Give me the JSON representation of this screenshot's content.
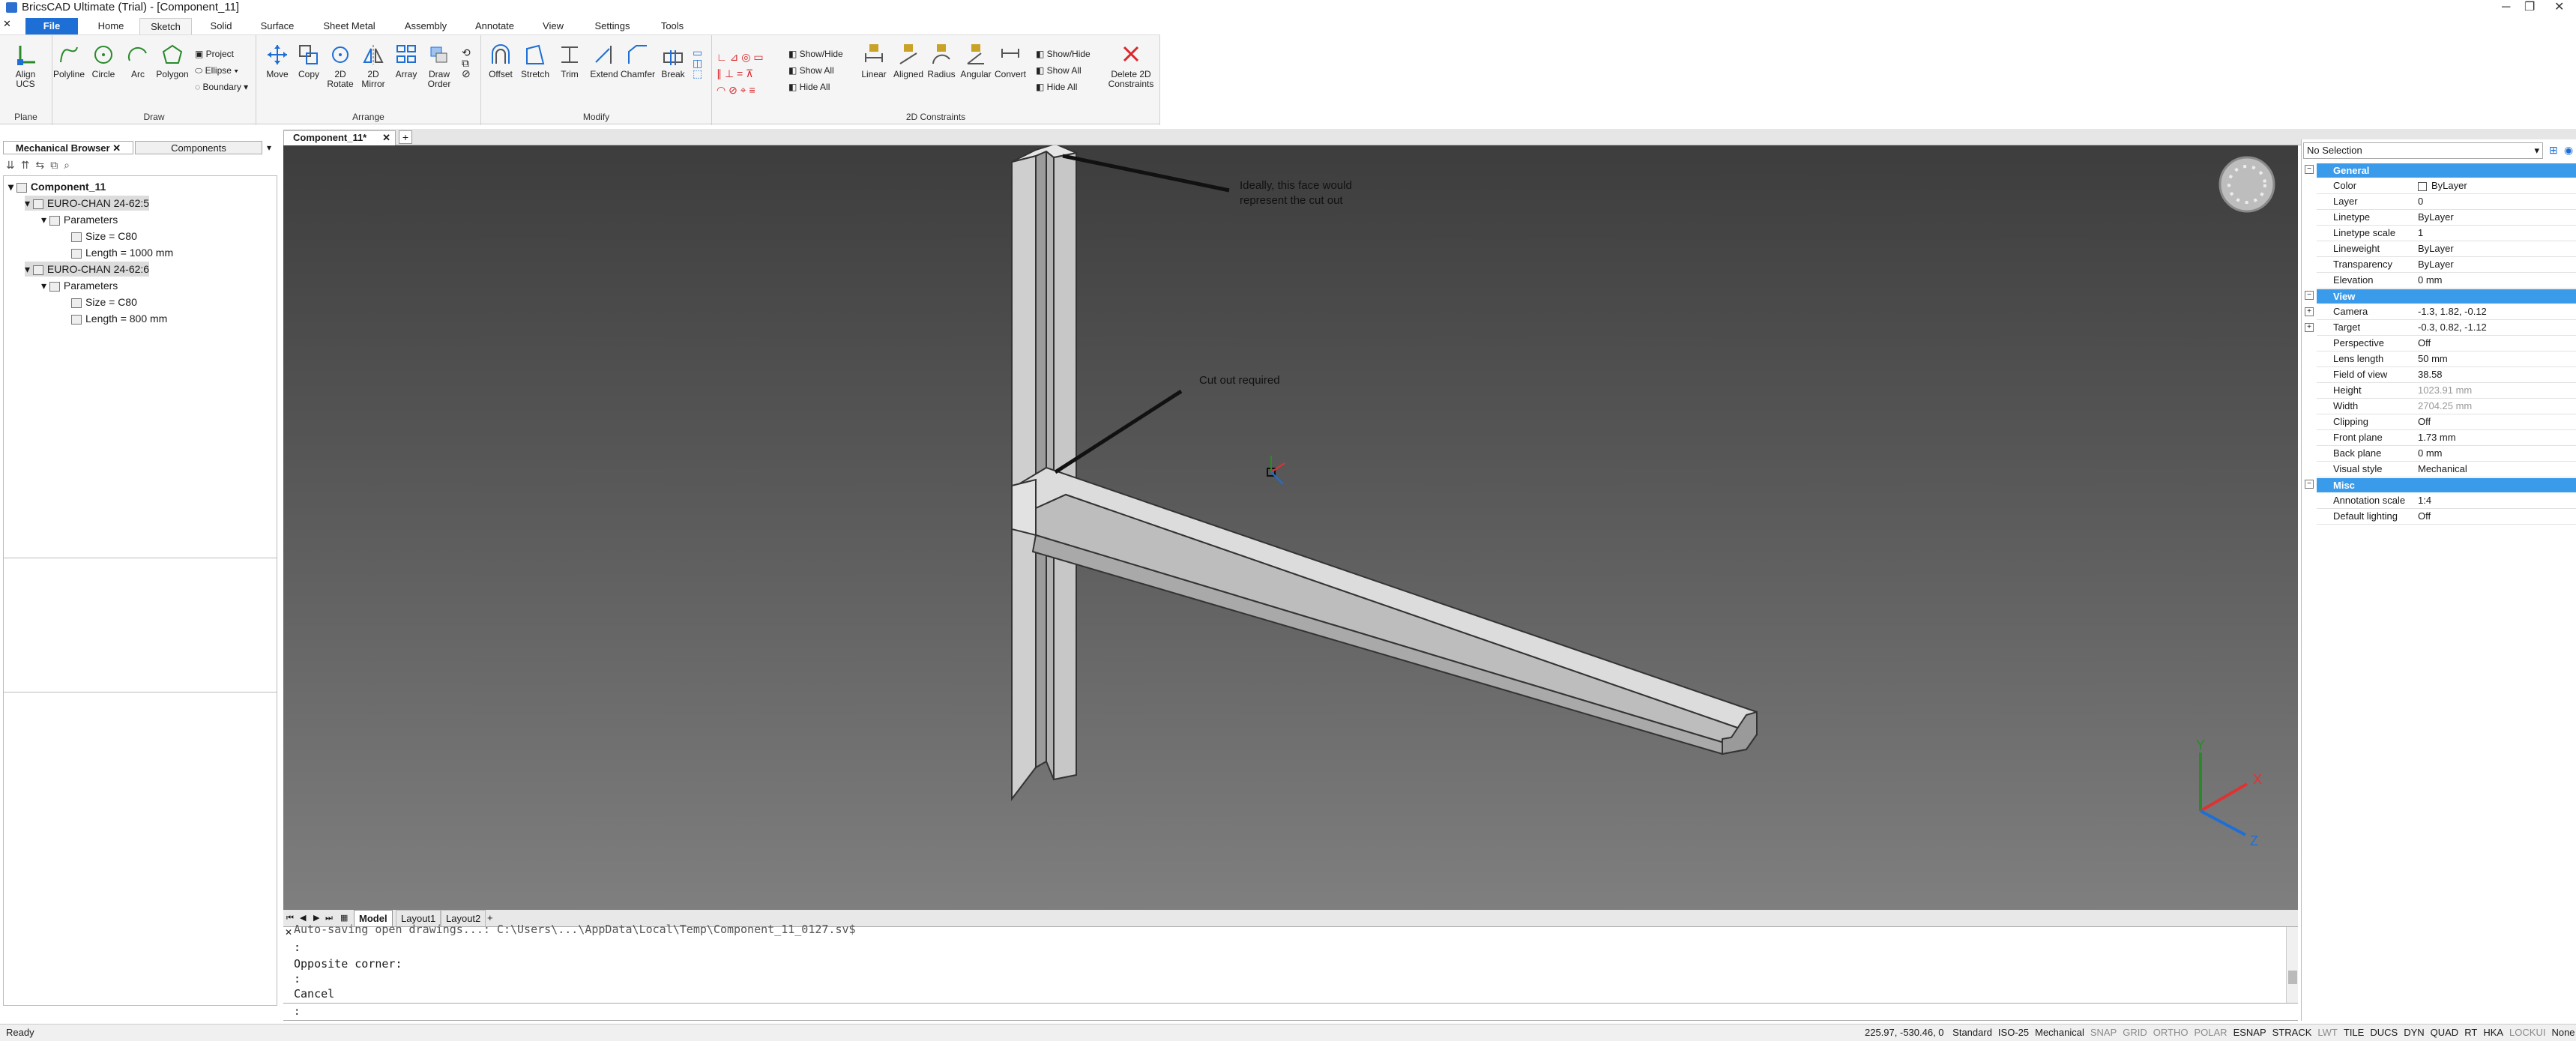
{
  "app": {
    "title": "BricsCAD Ultimate (Trial) - [Component_11]"
  },
  "ribbon": {
    "tabs": [
      "File",
      "Home",
      "Sketch",
      "Solid",
      "Surface",
      "Sheet Metal",
      "Assembly",
      "Annotate",
      "View",
      "Settings",
      "Tools"
    ],
    "active_tab": "Sketch",
    "groups": {
      "plane": {
        "label": "Plane",
        "align_ucs": "Align UCS"
      },
      "draw": {
        "label": "Draw",
        "polyline": "Polyline",
        "circle": "Circle",
        "arc": "Arc",
        "polygon": "Polygon",
        "project": "Project",
        "ellipse": "Ellipse",
        "boundary": "Boundary"
      },
      "arrange": {
        "label": "Arrange",
        "move": "Move",
        "copy": "Copy",
        "rotate2d": "2D Rotate",
        "mirror2d": "2D Mirror",
        "array": "Array",
        "draw_order": "Draw Order"
      },
      "modify": {
        "label": "Modify",
        "offset": "Offset",
        "stretch": "Stretch",
        "trim": "Trim",
        "extend": "Extend",
        "chamfer": "Chamfer",
        "break": "Break"
      },
      "constraints": {
        "label": "2D Constraints",
        "show_hide": "Show/Hide",
        "show_all": "Show All",
        "hide_all": "Hide All",
        "linear": "Linear",
        "aligned": "Aligned",
        "radius": "Radius",
        "angular": "Angular",
        "convert": "Convert",
        "show_hide2": "Show/Hide",
        "show_all2": "Show All",
        "hide_all2": "Hide All",
        "delete_2d": "Delete 2D Constraints"
      }
    }
  },
  "documents": {
    "active": "Component_11*"
  },
  "browser": {
    "tabs": [
      "Mechanical Browser",
      "Components"
    ],
    "tree": [
      {
        "label": "Component_11",
        "level": 0
      },
      {
        "label": "EURO-CHAN 24-62:5",
        "level": 1
      },
      {
        "label": "Parameters",
        "level": 2
      },
      {
        "label": "Size = C80",
        "level": 3
      },
      {
        "label": "Length = 1000 mm",
        "level": 3
      },
      {
        "label": "EURO-CHAN 24-62:6",
        "level": 1
      },
      {
        "label": "Parameters",
        "level": 2
      },
      {
        "label": "Size = C80",
        "level": 3
      },
      {
        "label": "Length = 800 mm",
        "level": 3
      }
    ]
  },
  "viewport": {
    "annotations": {
      "face_note": "Ideally, this face would represent the cut out",
      "cutout_note": "Cut out required"
    },
    "axes": {
      "x": "X",
      "y": "Y",
      "z": "Z"
    }
  },
  "layouts": {
    "tabs": [
      "Model",
      "Layout1",
      "Layout2"
    ],
    "active": "Model"
  },
  "command": {
    "lines": [
      "Auto-saving open drawings...: C:\\Users\\...\\AppData\\Local\\Temp\\Component_11_0127.sv$",
      ":",
      "Opposite corner:",
      ":",
      "Cancel"
    ],
    "prompt": ":"
  },
  "status": {
    "ready": "Ready",
    "coords": "225.97, -530.46, 0",
    "items": [
      "Standard",
      "ISO-25",
      "Mechanical",
      "SNAP",
      "GRID",
      "ORTHO",
      "POLAR",
      "ESNAP",
      "STRACK",
      "LWT",
      "TILE",
      "DUCS",
      "DYN",
      "QUAD",
      "RT",
      "HKA",
      "LOCKUI",
      "None"
    ]
  },
  "properties": {
    "selection": "No Selection",
    "sections": {
      "general": "General",
      "view": "View",
      "misc": "Misc"
    },
    "general": [
      {
        "k": "Color",
        "v": "ByLayer"
      },
      {
        "k": "Layer",
        "v": "0"
      },
      {
        "k": "Linetype",
        "v": "ByLayer"
      },
      {
        "k": "Linetype scale",
        "v": "1"
      },
      {
        "k": "Lineweight",
        "v": "ByLayer"
      },
      {
        "k": "Transparency",
        "v": "ByLayer"
      },
      {
        "k": "Elevation",
        "v": "0 mm"
      }
    ],
    "view": [
      {
        "k": "Camera",
        "v": "-1.3, 1.82, -0.12"
      },
      {
        "k": "Target",
        "v": "-0.3, 0.82, -1.12"
      },
      {
        "k": "Perspective",
        "v": "Off"
      },
      {
        "k": "Lens length",
        "v": "50 mm"
      },
      {
        "k": "Field of view",
        "v": "38.58"
      },
      {
        "k": "Height",
        "v": "1023.91 mm"
      },
      {
        "k": "Width",
        "v": "2704.25 mm"
      },
      {
        "k": "Clipping",
        "v": "Off"
      },
      {
        "k": "Front plane",
        "v": "1.73 mm"
      },
      {
        "k": "Back plane",
        "v": "0 mm"
      },
      {
        "k": "Visual style",
        "v": "Mechanical"
      }
    ],
    "misc": [
      {
        "k": "Annotation scale",
        "v": "1:4"
      },
      {
        "k": "Default lighting",
        "v": "Off"
      }
    ]
  },
  "colors": {
    "accent": "#1d6fd6",
    "section": "#3a9bea",
    "delete": "#d9262b"
  }
}
